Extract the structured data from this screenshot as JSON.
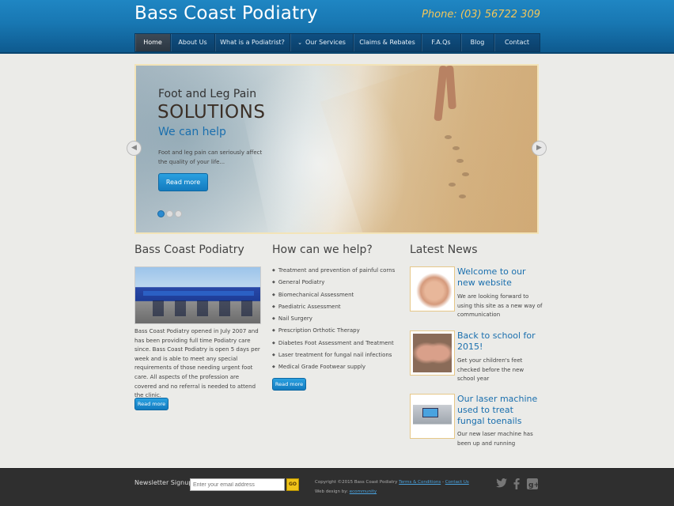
{
  "header": {
    "site_title": "Bass Coast Podiatry",
    "phone": "Phone: (03) 56722 309"
  },
  "nav": {
    "items": [
      {
        "label": "Home",
        "active": true
      },
      {
        "label": "About Us"
      },
      {
        "label": "What is a Podiatrist?"
      },
      {
        "label": "Our Services",
        "has_dropdown": true
      },
      {
        "label": "Claims & Rebates"
      },
      {
        "label": "F.A.Qs"
      },
      {
        "label": "Blog"
      },
      {
        "label": "Contact"
      }
    ]
  },
  "slider": {
    "pre_title": "Foot and Leg Pain",
    "big_title": "SOLUTIONS",
    "sub_title": "We can help",
    "description": "Foot and leg pain can seriously affect the quality of your life...",
    "button": "Read more",
    "slide_count": 3,
    "current_slide": 1
  },
  "about": {
    "title": "Bass Coast Podiatry",
    "text": "Bass Coast Podiatry opened in July 2007 and has been providing full time Podiatry care since. Bass Coast Podiatry is open 5 days per week and is able to meet any special requirements of those needing urgent foot care. All aspects of the profession are covered and no referral is needed to attend the clinic.",
    "button": "Read more"
  },
  "help": {
    "title": "How can we help?",
    "items": [
      "Treatment and prevention of painful corns",
      "General Podiatry",
      "Biomechanical Assessment",
      "Paediatric Assessment",
      "Nail Surgery",
      "Prescription Orthotic Therapy",
      "Diabetes Foot Assessment and Treatment",
      "Laser treatment for fungal nail infections",
      "Medical Grade Footwear supply"
    ],
    "button": "Read more"
  },
  "news": {
    "title": "Latest News",
    "items": [
      {
        "title": "Welcome to our new website",
        "text": "We are looking forward to using this site as a new way of communication"
      },
      {
        "title": "Back to school for 2015!",
        "text": "Get your children's feet checked before the new school year"
      },
      {
        "title": "Our laser machine used to treat fungal toenails",
        "text": "Our new laser machine has been up and running"
      }
    ]
  },
  "footer": {
    "newsletter_label": "Newsletter Signup",
    "email_placeholder": "Enter your email address",
    "go_label": "GO",
    "copyright": "Copyright ©2015 Bass Coast Podiatry",
    "terms": "Terms & Conditions",
    "separator": " - ",
    "contact_link": "Contact Us",
    "credit_prefix": "Web design by:",
    "credit_link": "ecommunity",
    "social": {
      "twitter": "twitter-icon",
      "facebook": "facebook-icon",
      "google": "google-plus-icon"
    }
  },
  "colors": {
    "brand_blue": "#1877b2",
    "accent_yellow": "#f2c75b",
    "link_blue": "#1a6fae"
  }
}
